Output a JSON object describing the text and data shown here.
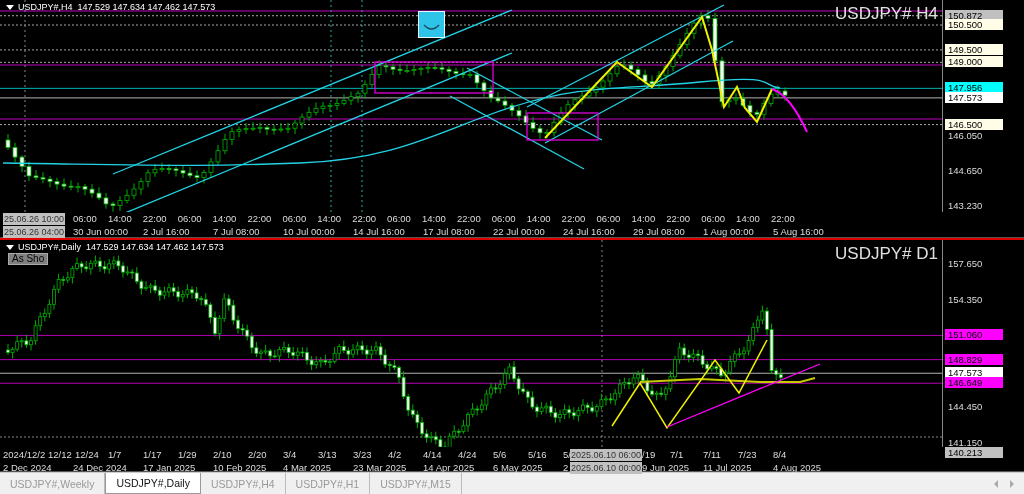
{
  "panes": [
    {
      "header": "USDJPY#,H4  147.529 147.634 147.462 147.573",
      "symbol_title": "USDJPY# H4",
      "price_labels": [
        {
          "text": "150.872",
          "kind": "dotted",
          "color": "#c0c0c0"
        },
        {
          "text": "150.500",
          "kind": "dotted",
          "color": "#fffde8"
        },
        {
          "text": "149.500",
          "kind": "dotted",
          "color": "#fffde8"
        },
        {
          "text": "149.000",
          "kind": "dotted",
          "color": "#fffde8"
        },
        {
          "text": "147.956",
          "kind": "solid",
          "color": "#00ffff"
        },
        {
          "text": "147.573",
          "kind": "solid",
          "color": "#ffffff"
        },
        {
          "text": "146.500",
          "kind": "dotted",
          "color": "#fffde8"
        },
        {
          "text": "146.050",
          "kind": "plain"
        },
        {
          "text": "144.650",
          "kind": "plain"
        },
        {
          "text": "143.230",
          "kind": "plain"
        }
      ],
      "time_row_1": [
        "06:00",
        "14:00",
        "22:00",
        "06:00",
        "14:00",
        "22:00",
        "06:00",
        "14:00",
        "22:00",
        "06:00",
        "14:00",
        "22:00",
        "06:00",
        "14:00",
        "22:00",
        "06:00",
        "14:00",
        "22:00",
        "06:00",
        "14:00",
        "22:00"
      ],
      "time_row_2": [
        "30 Jun 00:00",
        "2 Jul 16:00",
        "7 Jul 08:00",
        "10 Jul 00:00",
        "14 Jul 16:00",
        "17 Jul 08:00",
        "22 Jul 00:00",
        "24 Jul 16:00",
        "29 Jul 08:00",
        "1 Aug 00:00",
        "5 Aug 16:00"
      ],
      "cursor_labels": [
        "25.06.26 10:00",
        "25.06.26 04:00"
      ]
    },
    {
      "header": "USDJPY#,Daily  147.529 147.634 147.462 147.573",
      "symbol_title": "USDJPY# D1",
      "button": "As Sho",
      "price_labels": [
        {
          "text": "157.650",
          "kind": "plain"
        },
        {
          "text": "154.350",
          "kind": "plain"
        },
        {
          "text": "151.060",
          "kind": "solid",
          "color": "#ff00ff"
        },
        {
          "text": "148.829",
          "kind": "solid",
          "color": "#ff00ff"
        },
        {
          "text": "147.573",
          "kind": "solid",
          "color": "#ffffff"
        },
        {
          "text": "146.649",
          "kind": "solid",
          "color": "#ff00ff"
        },
        {
          "text": "144.450",
          "kind": "plain"
        },
        {
          "text": "141.150",
          "kind": "plain"
        },
        {
          "text": "140.213",
          "kind": "dotted",
          "color": "#c0c0c0"
        }
      ],
      "time_row_1": [
        "2024/12/2",
        "12/12",
        "12/24",
        "1/7",
        "1/17",
        "1/29",
        "2/10",
        "2/20",
        "3/4",
        "3/13",
        "3/23",
        "4/2",
        "4/14",
        "4/24",
        "5/6",
        "5/16",
        "5/",
        "/19",
        "7/1",
        "7/11",
        "7/23",
        "8/4"
      ],
      "time_row_2": [
        "2 Dec 2024",
        "24 Dec 2024",
        "17 Jan 2025",
        "10 Feb 2025",
        "4 Mar 2025",
        "23 Mar 2025",
        "14 Apr 2025",
        "6 May 2025",
        "2",
        "9 Jun 2025",
        "11 Jul 2025",
        "4 Aug 2025"
      ],
      "cursor_labels": [
        "2025.06.10 06:00",
        "2025.06.10 00:00"
      ]
    }
  ],
  "tabs": [
    {
      "label": "USDJPY#,Weekly",
      "selected": false
    },
    {
      "label": "USDJPY#,Daily",
      "selected": true
    },
    {
      "label": "USDJPY#,H4",
      "selected": false
    },
    {
      "label": "USDJPY#,H1",
      "selected": false
    },
    {
      "label": "USDJPY#,M15",
      "selected": false
    }
  ]
}
